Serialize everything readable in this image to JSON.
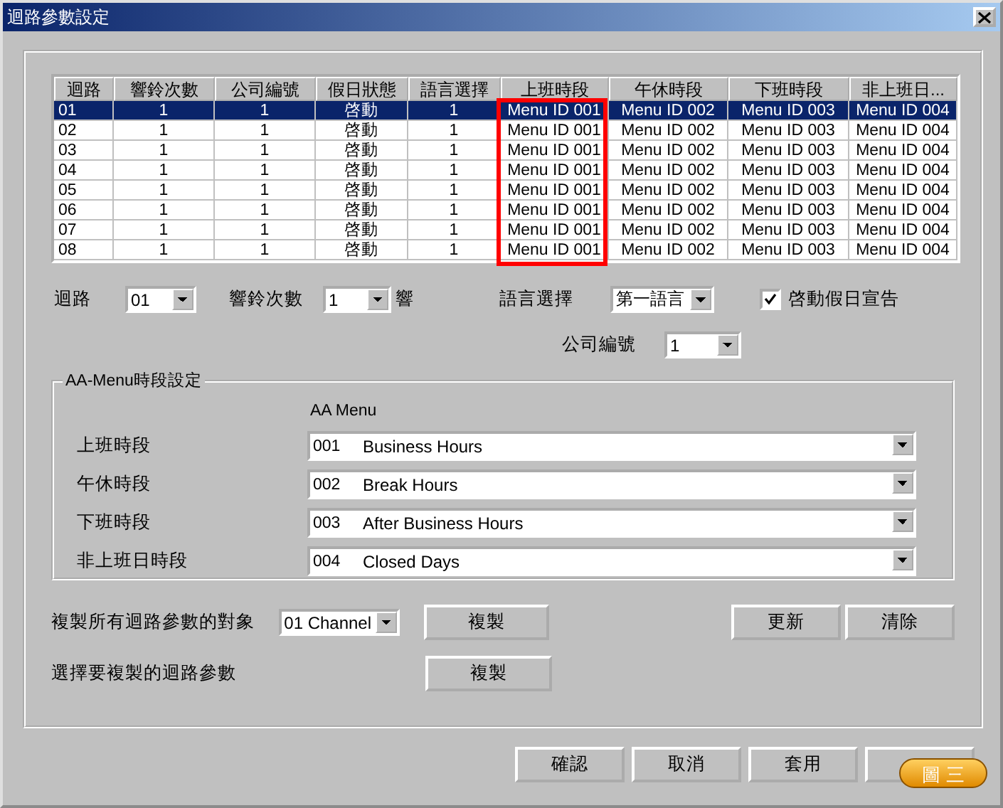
{
  "window": {
    "title": "迴路參數設定"
  },
  "table": {
    "columns": [
      {
        "label": "迴路",
        "highlighted": false
      },
      {
        "label": "響鈴次數",
        "highlighted": false
      },
      {
        "label": "公司編號",
        "highlighted": false
      },
      {
        "label": "假日狀態",
        "highlighted": false
      },
      {
        "label": "語言選擇",
        "highlighted": false
      },
      {
        "label": "上班時段",
        "highlighted": true
      },
      {
        "label": "午休時段",
        "highlighted": false
      },
      {
        "label": "下班時段",
        "highlighted": false
      },
      {
        "label": "非上班日...",
        "highlighted": false
      }
    ],
    "rows": [
      {
        "selected": true,
        "cells": [
          "01",
          "1",
          "1",
          "啓動",
          "1",
          "Menu ID 001",
          "Menu ID 002",
          "Menu ID 003",
          "Menu ID 004"
        ]
      },
      {
        "selected": false,
        "cells": [
          "02",
          "1",
          "1",
          "啓動",
          "1",
          "Menu ID 001",
          "Menu ID 002",
          "Menu ID 003",
          "Menu ID 004"
        ]
      },
      {
        "selected": false,
        "cells": [
          "03",
          "1",
          "1",
          "啓動",
          "1",
          "Menu ID 001",
          "Menu ID 002",
          "Menu ID 003",
          "Menu ID 004"
        ]
      },
      {
        "selected": false,
        "cells": [
          "04",
          "1",
          "1",
          "啓動",
          "1",
          "Menu ID 001",
          "Menu ID 002",
          "Menu ID 003",
          "Menu ID 004"
        ]
      },
      {
        "selected": false,
        "cells": [
          "05",
          "1",
          "1",
          "啓動",
          "1",
          "Menu ID 001",
          "Menu ID 002",
          "Menu ID 003",
          "Menu ID 004"
        ]
      },
      {
        "selected": false,
        "cells": [
          "06",
          "1",
          "1",
          "啓動",
          "1",
          "Menu ID 001",
          "Menu ID 002",
          "Menu ID 003",
          "Menu ID 004"
        ]
      },
      {
        "selected": false,
        "cells": [
          "07",
          "1",
          "1",
          "啓動",
          "1",
          "Menu ID 001",
          "Menu ID 002",
          "Menu ID 003",
          "Menu ID 004"
        ]
      },
      {
        "selected": false,
        "cells": [
          "08",
          "1",
          "1",
          "啓動",
          "1",
          "Menu ID 001",
          "Menu ID 002",
          "Menu ID 003",
          "Menu ID 004"
        ]
      }
    ]
  },
  "settings": {
    "channel": {
      "label": "迴路",
      "value": "01"
    },
    "rings": {
      "label": "響鈴次數",
      "value": "1",
      "suffix": "響"
    },
    "language": {
      "label": "語言選擇",
      "value": "第一語言"
    },
    "holiday_announce": {
      "label": "啓動假日宣告",
      "checked": true
    },
    "company": {
      "label": "公司編號",
      "value": "1"
    }
  },
  "aa_menu": {
    "title": "AA-Menu時段設定",
    "column_label": "AA Menu",
    "rows": [
      {
        "label": "上班時段",
        "code": "001",
        "name": "Business Hours"
      },
      {
        "label": "午休時段",
        "code": "002",
        "name": "Break Hours"
      },
      {
        "label": "下班時段",
        "code": "003",
        "name": "After Business Hours"
      },
      {
        "label": "非上班日時段",
        "code": "004",
        "name": "Closed Days"
      }
    ]
  },
  "copy_all": {
    "label": "複製所有迴路參數的對象",
    "value": "01 Channel",
    "button": "複製"
  },
  "copy_select": {
    "label": "選擇要複製的迴路參數",
    "button": "複製"
  },
  "side_buttons": [
    "更新",
    "清除"
  ],
  "buttons": [
    "確認",
    "取消",
    "套用"
  ],
  "badge": "圖三"
}
